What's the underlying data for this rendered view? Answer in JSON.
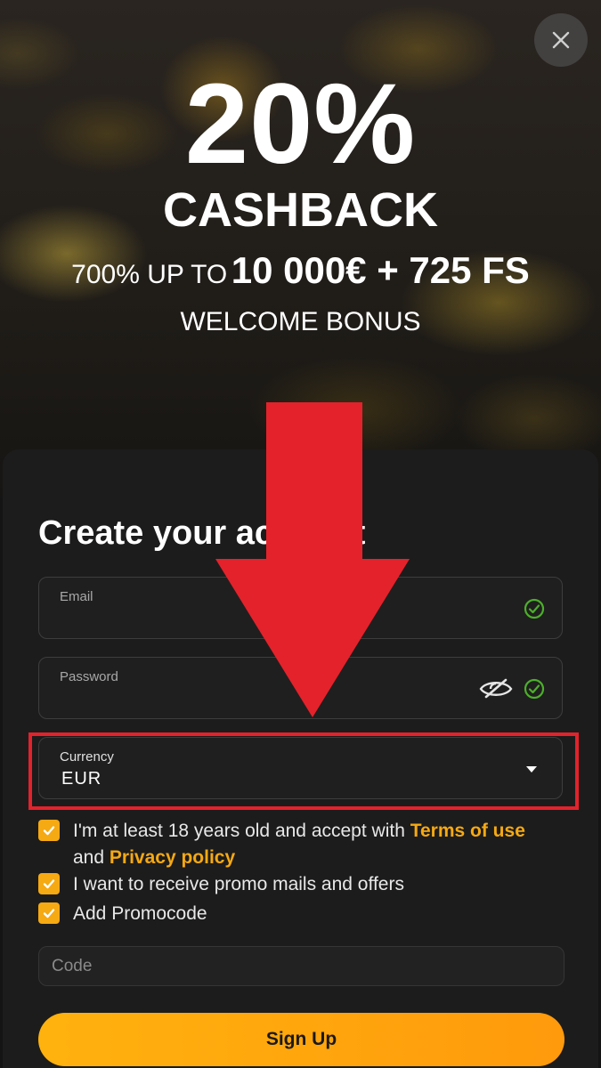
{
  "promo": {
    "percent": "20%",
    "cashback": "CASHBACK",
    "offer_prefix": "700% UP TO",
    "offer_amount": "10 000€ + 725 FS",
    "welcome": "WELCOME BONUS"
  },
  "form": {
    "title": "Create your account",
    "email_label": "Email",
    "password_label": "Password",
    "currency_label": "Currency",
    "currency_value": "EUR",
    "code_placeholder": "Code",
    "signup_label": "Sign Up"
  },
  "checkboxes": {
    "age_text": "I'm at least 18 years old and accept with",
    "terms_link": "Terms of use",
    "and_text": "and",
    "privacy_link": "Privacy policy",
    "promo_mails": "I want to receive promo mails and offers",
    "add_promocode": "Add Promocode",
    "age_checked": true,
    "promo_mails_checked": true,
    "add_promocode_checked": true
  },
  "icons": {
    "close": "close-icon",
    "email_valid": "check-circle-icon",
    "password_toggle": "eye-slash-icon",
    "password_valid": "check-circle-icon",
    "currency_dropdown": "caret-down-icon",
    "checkbox_check": "checkmark-icon",
    "annotation_arrow": "down-arrow-icon"
  },
  "colors": {
    "accent": "#f5a913",
    "valid_green": "#4caf2a",
    "annotation_red": "#e4222b",
    "button_gradient_start": "#ffb20e",
    "button_gradient_end": "#ff9a0c"
  }
}
